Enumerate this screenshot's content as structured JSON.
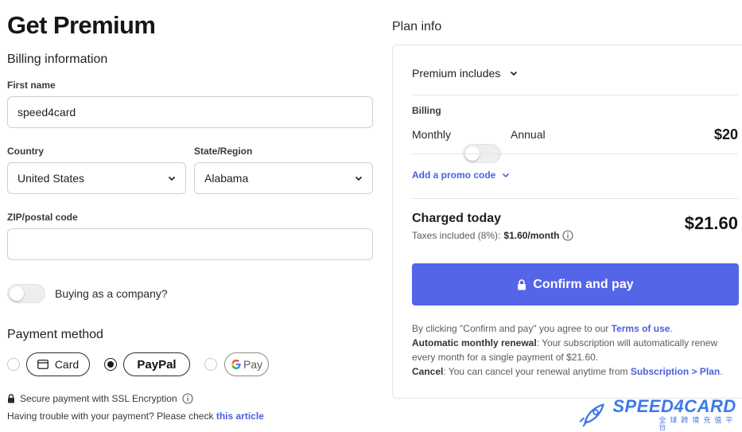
{
  "header": {
    "title": "Get Premium"
  },
  "billing": {
    "section_title": "Billing information",
    "first_name": {
      "label": "First name",
      "value": "speed4card"
    },
    "country": {
      "label": "Country",
      "value": "United States"
    },
    "state": {
      "label": "State/Region",
      "value": "Alabama"
    },
    "zip": {
      "label": "ZIP/postal code",
      "value": "",
      "placeholder": ""
    },
    "company_toggle": {
      "label": "Buying as a company?",
      "on": false
    }
  },
  "payment": {
    "section_title": "Payment method",
    "options": [
      {
        "label": "Card",
        "selected": false
      },
      {
        "label": "PayPal",
        "selected": true
      },
      {
        "label": "Pay",
        "selected": false
      }
    ],
    "secure_text": "Secure payment with SSL Encryption",
    "trouble_text": "Having trouble with your payment? Please check",
    "trouble_link": "this article"
  },
  "plan": {
    "section_title": "Plan info",
    "includes_label": "Premium includes",
    "billing_label": "Billing",
    "monthly_label": "Monthly",
    "annual_label": "Annual",
    "annual_on": false,
    "price": "$20",
    "promo_label": "Add a promo code",
    "charged_label": "Charged today",
    "taxes_prefix": "Taxes included (8%):",
    "taxes_value": "$1.60/month",
    "total": "$21.60",
    "confirm_label": "Confirm and pay",
    "legal": {
      "line1_prefix": "By clicking \"Confirm and pay\" you agree to our ",
      "terms_link": "Terms of use",
      "line1_suffix": ".",
      "renewal_bold": "Automatic monthly renewal",
      "renewal_text": ": Your subscription will automatically renew every month for a single payment of $21.60.",
      "cancel_bold": "Cancel",
      "cancel_text": ": You can cancel your renewal anytime from ",
      "cancel_link": "Subscription > Plan",
      "cancel_suffix": "."
    }
  },
  "watermark": {
    "brand": "SPEED4CARD",
    "tagline": "全球跨境充值平台"
  },
  "colors": {
    "accent": "#5465e8",
    "link": "#4a5fe0",
    "border": "#cfcfcf"
  }
}
